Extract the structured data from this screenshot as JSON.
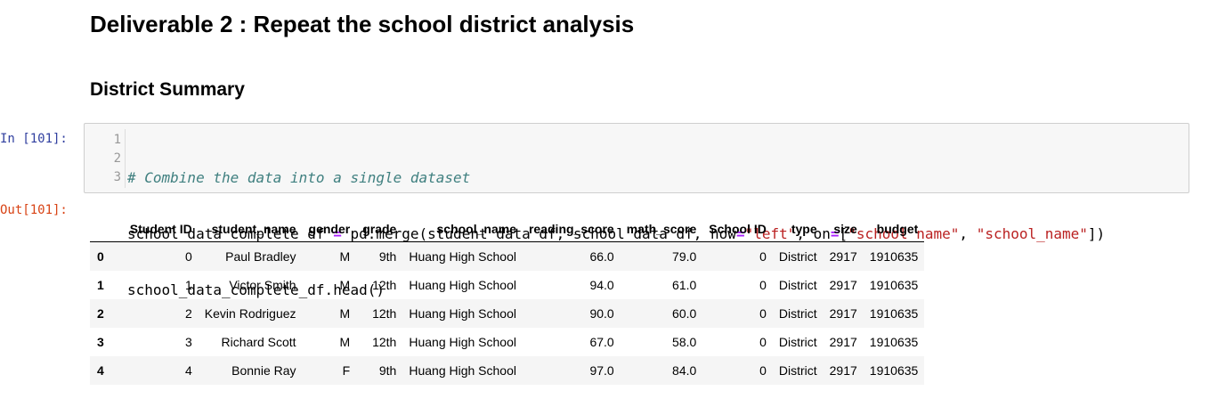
{
  "headings": {
    "deliverable": "Deliverable 2 : Repeat the school district analysis",
    "section": "District Summary"
  },
  "prompts": {
    "in": "In [101]:",
    "out": "Out[101]:"
  },
  "code": {
    "line_numbers": [
      "1",
      "2",
      "3"
    ],
    "line1": {
      "comment": "# Combine the data into a single dataset"
    },
    "line2": {
      "a": "school_data_complete_df ",
      "op1": "=",
      "b": " pd.merge(student_data_df, school_data_df, how",
      "op2": "=",
      "s1": "\"left\"",
      "c": ", on",
      "op3": "=",
      "d": "[",
      "s2": "\"school_name\"",
      "e": ", ",
      "s3": "\"school_name\"",
      "f": "])"
    },
    "line3": {
      "text": "school_data_complete_df.head()"
    }
  },
  "table": {
    "columns": [
      "",
      "Student ID",
      "student_name",
      "gender",
      "grade",
      "school_name",
      "reading_score",
      "math_score",
      "School ID",
      "type",
      "size",
      "budget"
    ],
    "rows": [
      [
        "0",
        "0",
        "Paul Bradley",
        "M",
        "9th",
        "Huang High School",
        "66.0",
        "79.0",
        "0",
        "District",
        "2917",
        "1910635"
      ],
      [
        "1",
        "1",
        "Victor Smith",
        "M",
        "12th",
        "Huang High School",
        "94.0",
        "61.0",
        "0",
        "District",
        "2917",
        "1910635"
      ],
      [
        "2",
        "2",
        "Kevin Rodriguez",
        "M",
        "12th",
        "Huang High School",
        "90.0",
        "60.0",
        "0",
        "District",
        "2917",
        "1910635"
      ],
      [
        "3",
        "3",
        "Richard Scott",
        "M",
        "12th",
        "Huang High School",
        "67.0",
        "58.0",
        "0",
        "District",
        "2917",
        "1910635"
      ],
      [
        "4",
        "4",
        "Bonnie Ray",
        "F",
        "9th",
        "Huang High School",
        "97.0",
        "84.0",
        "0",
        "District",
        "2917",
        "1910635"
      ]
    ]
  }
}
